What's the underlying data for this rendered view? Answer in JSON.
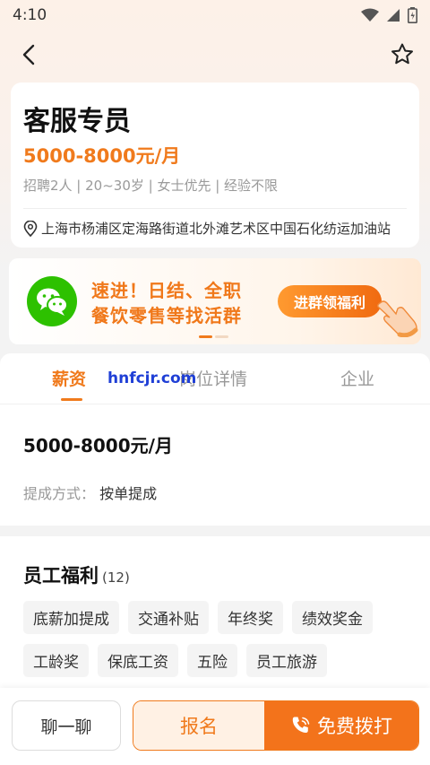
{
  "status_bar": {
    "time": "4:10"
  },
  "job": {
    "title": "客服专员",
    "salary": "5000-8000元/月",
    "tags": "招聘2人 | 20~30岁 | 女士优先 | 经验不限",
    "address": "上海市杨浦区定海路街道北外滩艺术区中国石化纺运加油站"
  },
  "banner": {
    "line1": "速进！日结、全职",
    "line2": "餐饮零售等找活群",
    "button": "进群领福利"
  },
  "tabs": [
    {
      "label": "薪资",
      "active": true
    },
    {
      "label": "岗位详情",
      "active": false
    },
    {
      "label": "企业",
      "active": false
    }
  ],
  "watermark": "hnfcjr.com",
  "salary_section": {
    "amount": "5000-8000元/月",
    "method_label": "提成方式：",
    "method_value": "按单提成"
  },
  "benefits": {
    "title": "员工福利",
    "count": "(12)",
    "items": [
      "底薪加提成",
      "交通补贴",
      "年终奖",
      "绩效奖金",
      "工龄奖",
      "保底工资",
      "五险",
      "员工旅游"
    ]
  },
  "bottom_bar": {
    "chat": "聊一聊",
    "apply": "报名",
    "call": "免费拨打"
  },
  "colors": {
    "accent": "#f07a1c",
    "wechat_green": "#2dc100"
  },
  "icons": [
    "back-arrow-icon",
    "star-icon",
    "location-pin-icon",
    "wechat-icon",
    "hand-pointer-icon",
    "phone-icon",
    "wifi-icon",
    "signal-icon",
    "battery-icon"
  ]
}
